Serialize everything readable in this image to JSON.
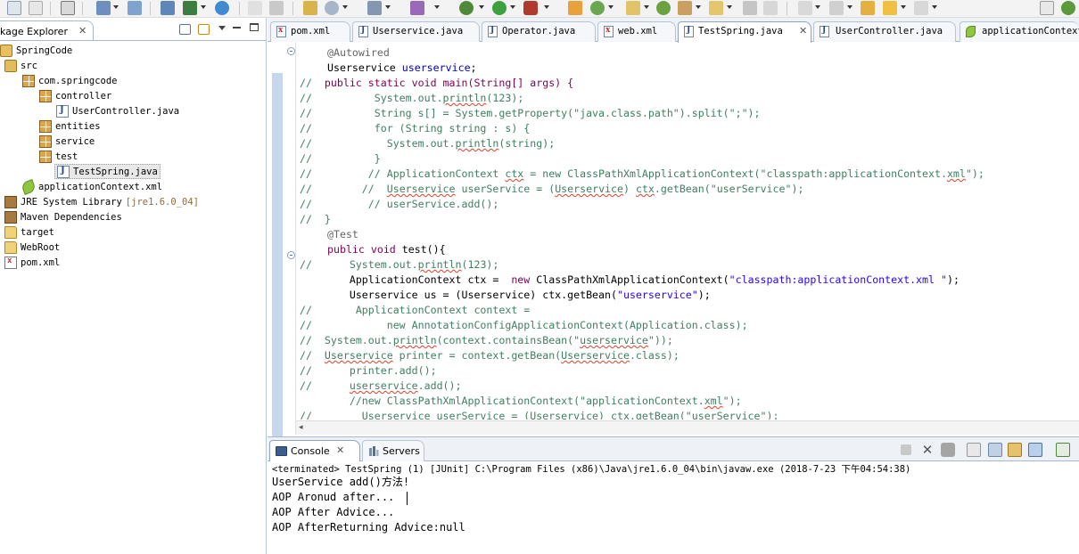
{
  "explorer": {
    "tab_label": "kage Explorer",
    "tree": [
      {
        "label": "SpringCode",
        "icon": "project-icon"
      },
      {
        "label": "src",
        "icon": "source-folder-icon"
      },
      {
        "label": "com.springcode",
        "icon": "package-icon"
      },
      {
        "label": "controller",
        "icon": "package-icon"
      },
      {
        "label": "UserController.java",
        "icon": "java-file-icon"
      },
      {
        "label": "entities",
        "icon": "package-icon"
      },
      {
        "label": "service",
        "icon": "package-icon"
      },
      {
        "label": "test",
        "icon": "package-icon"
      },
      {
        "label": "TestSpring.java",
        "icon": "java-file-icon"
      },
      {
        "label": "applicationContext.xml",
        "icon": "spring-leaf-icon"
      },
      {
        "label": "JRE System Library",
        "icon": "library-icon",
        "suffix": "[jre1.6.0_04]"
      },
      {
        "label": "Maven Dependencies",
        "icon": "library-icon"
      },
      {
        "label": "target",
        "icon": "folder-icon"
      },
      {
        "label": "WebRoot",
        "icon": "folder-icon"
      },
      {
        "label": "pom.xml",
        "icon": "xml-file-icon"
      }
    ]
  },
  "editor": {
    "tabs": [
      {
        "label": "pom.xml",
        "icon": "xml-file-icon",
        "active": false
      },
      {
        "label": "Userservice.java",
        "icon": "java-file-icon",
        "active": false
      },
      {
        "label": "Operator.java",
        "icon": "java-file-icon",
        "active": false
      },
      {
        "label": "web.xml",
        "icon": "xml-file-icon",
        "active": false
      },
      {
        "label": "TestSpring.java",
        "icon": "java-file-icon",
        "active": true
      },
      {
        "label": "UserController.java",
        "icon": "java-file-icon",
        "active": false
      },
      {
        "label": "applicationContext",
        "icon": "spring-leaf-icon",
        "active": false
      }
    ],
    "code": {
      "l0": "@Autowired",
      "l1a": "Userservice ",
      "l1b": "userservice",
      "l1c": ";",
      "l2a": "//  ",
      "l2b": "public static void main(String[] args) {",
      "l3a": "//          System.out.",
      "l3b": "println",
      "l3c": "(123);",
      "l4": "//          String s[] = System.getProperty(\"java.class.path\").split(\";\");",
      "l5": "//          for (String string : s) {",
      "l6a": "//            System.out.",
      "l6b": "println",
      "l6c": "(string);",
      "l7": "//          }",
      "l8a": "//         // ApplicationContext ",
      "l8b": "ctx",
      "l8c": " = new ClassPathXmlApplicationContext(\"classpath:applicationContext.",
      "l8d": "xml",
      "l8e": "\");",
      "l9a": "//        //  ",
      "l9b": "Userservice",
      "l9c": " userService = (",
      "l9d": "Userservice",
      "l9e": ") ",
      "l9f": "ctx",
      "l9g": ".getBean(\"userService\");",
      "l10": "//         // userService.add();",
      "l11": "//  }",
      "l12": "@Test",
      "l13a": "public void",
      "l13b": " test(){",
      "l14a": "//      System.out.",
      "l14b": "println",
      "l14c": "(123);",
      "l15a": "        ApplicationContext ctx =  ",
      "l15b": "new",
      "l15c": " ClassPathXmlApplicationContext(",
      "l15d": "\"classpath:applicationContext.xml \"",
      "l15e": ");",
      "l16a": "        Userservice us = (Userservice) ctx.getBean(",
      "l16b": "\"userservice\"",
      "l16c": ");",
      "l17": "//       ApplicationContext context =",
      "l18": "//            new AnnotationConfigApplicationContext(Application.class);",
      "l19a": "//  System.out.",
      "l19b": "println",
      "l19c": "(context.containsBean(\"",
      "l19d": "userservice",
      "l19e": "\"));",
      "l20a": "//  ",
      "l20b": "Userservice",
      "l20c": " printer = context.getBean(",
      "l20d": "Userservice",
      "l20e": ".class);",
      "l21": "//      printer.add();",
      "l22a": "//      ",
      "l22b": "userservice",
      "l22c": ".add();",
      "l23a": "        //new ClassPathXmlApplicationContext(\"applicationContext.",
      "l23b": "xml",
      "l23c": "\");",
      "l24": "//        Userservice userService = (Userservice) ctx.getBean(\"userService\");"
    }
  },
  "console": {
    "tab_console": "Console",
    "tab_servers": "Servers",
    "terminated": "<terminated> TestSpring (1) [JUnit] C:\\Program Files (x86)\\Java\\jre1.6.0_04\\bin\\javaw.exe (2018-7-23 下午04:54:38)",
    "output": [
      "UserService add()方法!",
      "AOP Aronud after...",
      "AOP After Advice...",
      "AOP AfterReturning Advice:null"
    ]
  },
  "colors": {
    "comment": "#3f7f5f",
    "keyword": "#7f0055",
    "field": "#0000c0",
    "string": "#2a00ff",
    "annotation": "#646464"
  }
}
